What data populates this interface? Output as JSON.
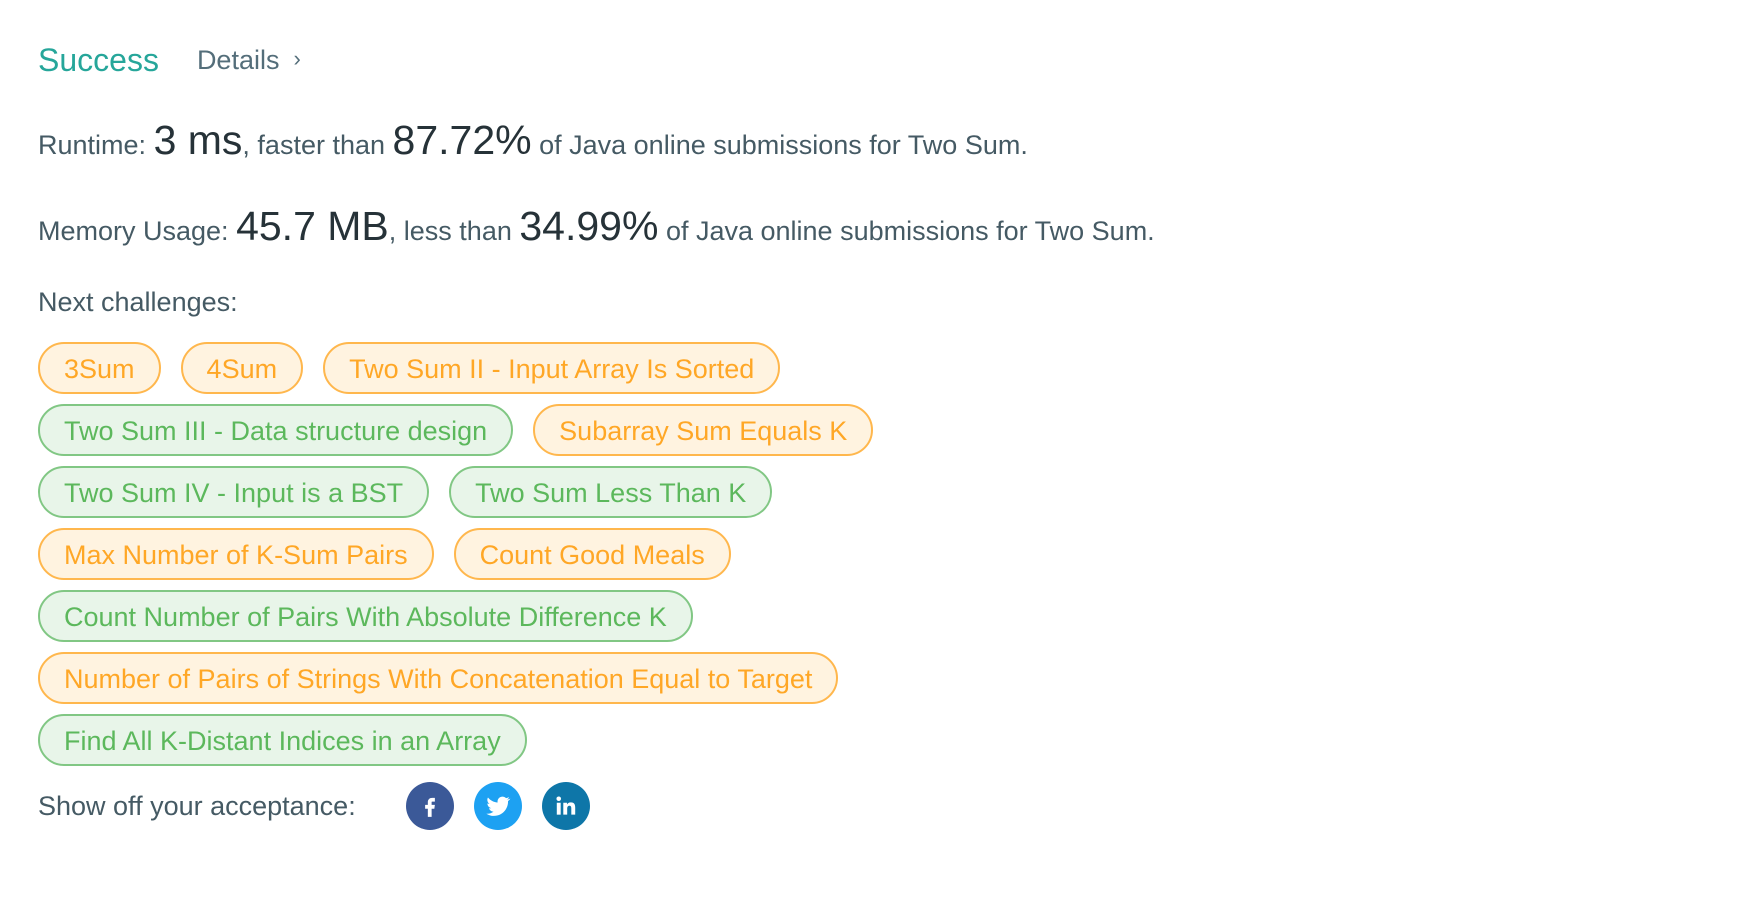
{
  "header": {
    "status": "Success",
    "details_label": "Details",
    "details_chevron": "›"
  },
  "runtime": {
    "label": "Runtime:",
    "value": "3 ms",
    "mid": ", faster than",
    "percent": "87.72%",
    "tail": "of Java online submissions for Two Sum."
  },
  "memory": {
    "label": "Memory Usage:",
    "value": "45.7 MB",
    "mid": ", less than",
    "percent": "34.99%",
    "tail": "of Java online submissions for Two Sum."
  },
  "next": {
    "label": "Next challenges:",
    "rows": [
      [
        {
          "label": "3Sum",
          "difficulty": "medium"
        },
        {
          "label": "4Sum",
          "difficulty": "medium"
        },
        {
          "label": "Two Sum II - Input Array Is Sorted",
          "difficulty": "medium"
        }
      ],
      [
        {
          "label": "Two Sum III - Data structure design",
          "difficulty": "easy"
        },
        {
          "label": "Subarray Sum Equals K",
          "difficulty": "medium"
        }
      ],
      [
        {
          "label": "Two Sum IV - Input is a BST",
          "difficulty": "easy"
        },
        {
          "label": "Two Sum Less Than K",
          "difficulty": "easy"
        }
      ],
      [
        {
          "label": "Max Number of K-Sum Pairs",
          "difficulty": "medium"
        },
        {
          "label": "Count Good Meals",
          "difficulty": "medium"
        }
      ],
      [
        {
          "label": "Count Number of Pairs With Absolute Difference K",
          "difficulty": "easy"
        }
      ],
      [
        {
          "label": "Number of Pairs of Strings With Concatenation Equal to Target",
          "difficulty": "medium"
        }
      ],
      [
        {
          "label": "Find All K-Distant Indices in an Array",
          "difficulty": "easy"
        }
      ]
    ]
  },
  "share": {
    "label": "Show off your acceptance:",
    "icons": [
      {
        "name": "facebook-icon",
        "color": "#3b5998"
      },
      {
        "name": "twitter-icon",
        "color": "#1da1f2"
      },
      {
        "name": "linkedin-icon",
        "color": "#0e76a8"
      }
    ]
  },
  "colors": {
    "success": "#26a69a",
    "medium": "#ffa726",
    "medium_bg": "#fff3e0",
    "easy": "#5cb85c",
    "easy_bg": "#e8f5e9"
  }
}
